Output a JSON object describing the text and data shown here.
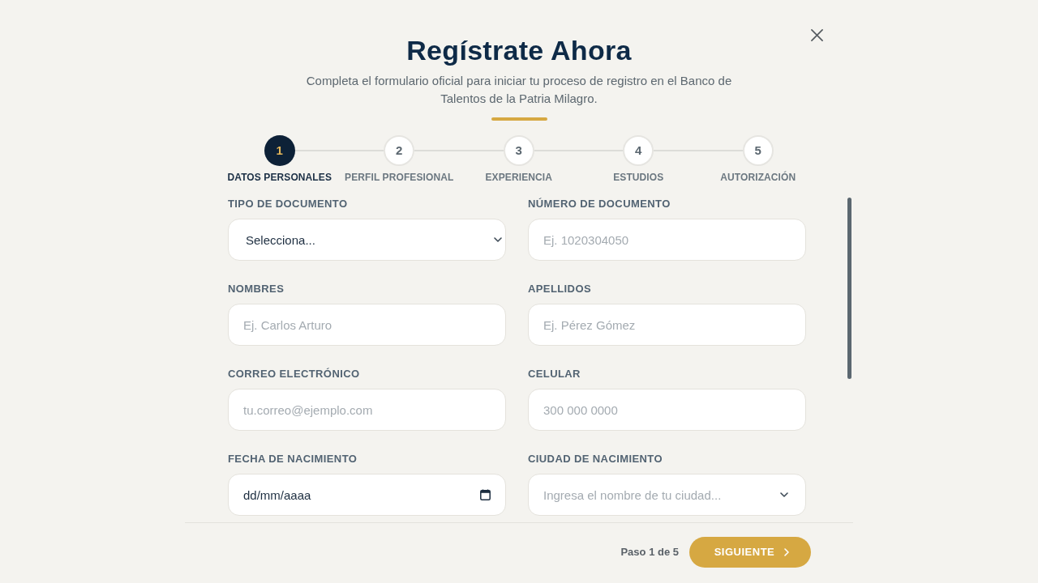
{
  "dialog": {
    "title": "Regístrate Ahora",
    "subtitle": "Completa el formulario oficial para iniciar tu proceso de registro en el Banco de Talentos de la Patria Milagro."
  },
  "steps": [
    {
      "number": "1",
      "label": "DATOS PERSONALES",
      "selected": true
    },
    {
      "number": "2",
      "label": "PERFIL PROFESIONAL",
      "selected": false
    },
    {
      "number": "3",
      "label": "EXPERIENCIA",
      "selected": false
    },
    {
      "number": "4",
      "label": "ESTUDIOS",
      "selected": false
    },
    {
      "number": "5",
      "label": "AUTORIZACIÓN",
      "selected": false
    }
  ],
  "fields": [
    {
      "kind": "select",
      "label": "TIPO DE DOCUMENTO",
      "value": "Selecciona..."
    },
    {
      "kind": "text",
      "label": "NÚMERO DE DOCUMENTO",
      "placeholder": "Ej. 1020304050"
    },
    {
      "kind": "text",
      "label": "NOMBRES",
      "placeholder": "Ej. Carlos Arturo"
    },
    {
      "kind": "text",
      "label": "APELLIDOS",
      "placeholder": "Ej. Pérez Gómez"
    },
    {
      "kind": "text",
      "label": "CORREO ELECTRÓNICO",
      "placeholder": "tu.correo@ejemplo.com"
    },
    {
      "kind": "text",
      "label": "CELULAR",
      "placeholder": "300 000 0000"
    },
    {
      "kind": "date",
      "label": "FECHA DE NACIMIENTO",
      "value": "dd/mm/aaaa"
    },
    {
      "kind": "combobox",
      "label": "CIUDAD DE NACIMIENTO",
      "placeholder": "Ingresa el nombre de tu ciudad..."
    }
  ],
  "footer": {
    "progress": "Paso 1 de 5",
    "next_button": "SIGUIENTE"
  }
}
